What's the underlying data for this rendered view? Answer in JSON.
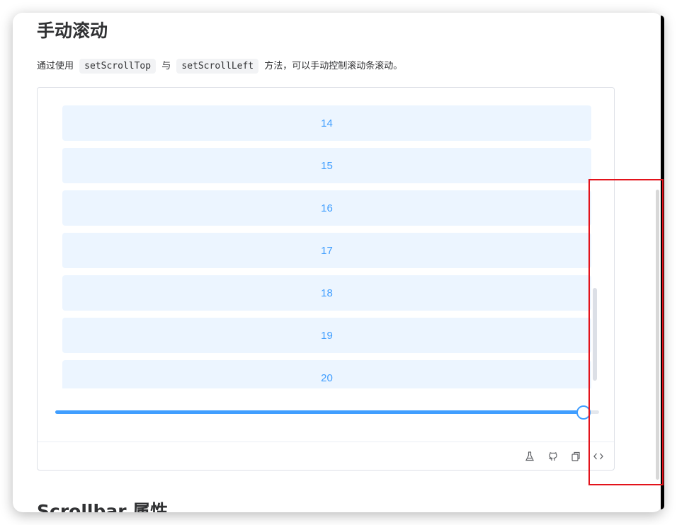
{
  "section": {
    "title": "手动滚动",
    "desc_before": "通过使用",
    "code_scroll_top": "setScrollTop",
    "desc_middle": "与",
    "code_scroll_left": "setScrollLeft",
    "desc_after": "方法，可以手动控制滚动条滚动。"
  },
  "demo": {
    "items": [
      "14",
      "15",
      "16",
      "17",
      "18",
      "19",
      "20"
    ],
    "slider": {
      "value_percent": 97
    },
    "footer_icons": [
      "flask-icon",
      "github-icon",
      "copy-icon",
      "code-icon"
    ]
  },
  "next_section": {
    "title": "Scrollbar 属性"
  },
  "colors": {
    "accent": "#409eff",
    "item_bg": "#ecf5ff",
    "highlight": "#e3131b"
  }
}
